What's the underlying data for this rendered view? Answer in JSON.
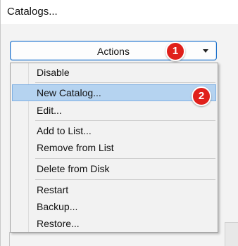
{
  "window": {
    "title": "Catalogs..."
  },
  "actions": {
    "label": "Actions"
  },
  "annotations": {
    "badge_1": "1",
    "badge_2": "2"
  },
  "menu": {
    "items": [
      {
        "label": "Disable"
      },
      {
        "label": "New Catalog...",
        "highlighted": true
      },
      {
        "label": "Edit..."
      },
      {
        "label": "Add to List..."
      },
      {
        "label": "Remove from List"
      },
      {
        "label": "Delete from Disk"
      },
      {
        "label": "Restart"
      },
      {
        "label": "Backup..."
      },
      {
        "label": "Restore..."
      }
    ]
  },
  "colors": {
    "highlight": "#b5d3f0",
    "badge": "#e0201b",
    "focus_border": "#1a6fc9"
  }
}
